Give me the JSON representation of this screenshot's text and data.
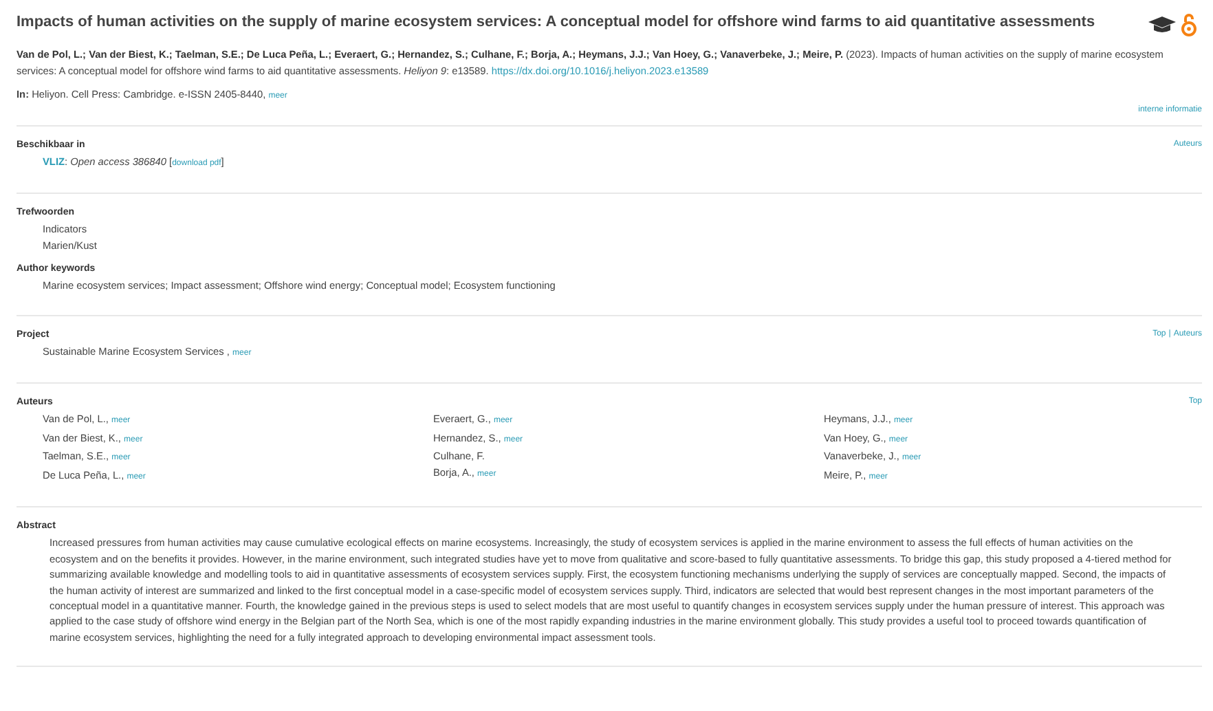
{
  "title": "Impacts of human activities on the supply of marine ecosystem services: A conceptual model for offshore wind farms to aid quantitative assessments",
  "citation": {
    "text": "**Van de Pol, L.; Van der Biest, K.; Taelman, S.E.; De Luca Peña, L.; Everaert, G.; Hernandez, S.; Culhane, F.; Borja, A.; Heymans, J.J.; Van Hoey, G.; Vanaverbeke, J.; Meire, P.** (2023). Impacts of human activities on the supply of marine ecosystem services: A conceptual model for offshore wind farms to aid quantitative assessments. *Heliyon 9*: e13589.",
    "link": "https://dx.doi.org/10.1016/j.heliyon.2023.e13589"
  },
  "source": {
    "label": "In:",
    "text": "Heliyon. Cell Press: Cambridge. e-ISSN 2405-8440,",
    "more": "meer"
  },
  "internal_link": "interne informatie",
  "available": {
    "heading": "Beschikbaar in",
    "nav": [
      "Auteurs"
    ],
    "org": "VLIZ",
    "text": ": *Open access 386840* [",
    "download": "download pdf",
    "close": "]"
  },
  "keywords": {
    "heading": "Trefwoorden",
    "items": [
      "Indicators",
      "Marien/Kust"
    ]
  },
  "author_keywords": {
    "heading": "Author keywords",
    "text": "Marine ecosystem services; Impact assessment; Offshore wind energy; Conceptual model; Ecosystem functioning"
  },
  "project": {
    "heading": "Project",
    "nav": [
      "Top",
      "Auteurs"
    ],
    "nav_separator": "|",
    "items": [
      {
        "name": "Sustainable Marine Ecosystem Services ,",
        "more": "meer"
      }
    ]
  },
  "authors": {
    "heading": "Auteurs",
    "nav": [
      "Top"
    ],
    "columns": [
      [
        {
          "name": "Van de Pol, L.,",
          "more": "meer"
        },
        {
          "name": "Van der Biest, K.,",
          "more": "meer"
        },
        {
          "name": "Taelman, S.E.,",
          "more": "meer"
        },
        {
          "name": "De Luca Peña, L.,",
          "more": "meer"
        }
      ],
      [
        {
          "name": "Everaert, G.,",
          "more": "meer"
        },
        {
          "name": "Hernandez, S.,",
          "more": "meer"
        },
        {
          "name": "Culhane, F."
        },
        {
          "name": "Borja, A.,",
          "more": "meer"
        }
      ],
      [
        {
          "name": "Heymans, J.J.,",
          "more": "meer"
        },
        {
          "name": "Van Hoey, G.,",
          "more": "meer"
        },
        {
          "name": "Vanaverbeke, J.,",
          "more": "meer"
        },
        {
          "name": "Meire, P.,",
          "more": "meer"
        }
      ]
    ]
  },
  "abstract": {
    "heading": "Abstract",
    "text": "Increased pressures from human activities may cause cumulative ecological effects on marine ecosystems. Increasingly, the study of ecosystem services is applied in the marine environment to assess the full effects of human activities on the ecosystem and on the benefits it provides. However, in the marine environment, such integrated studies have yet to move from qualitative and score-based to fully quantitative assessments. To bridge this gap, this study proposed a 4-tiered method for summarizing available knowledge and modelling tools to aid in quantitative assessments of ecosystem services supply. First, the ecosystem functioning mechanisms underlying the supply of services are conceptually mapped. Second, the impacts of the human activity of interest are summarized and linked to the first conceptual model in a case-specific model of ecosystem services supply. Third, indicators are selected that would best represent changes in the most important parameters of the conceptual model in a quantitative manner. Fourth, the knowledge gained in the previous steps is used to select models that are most useful to quantify changes in ecosystem services supply under the human pressure of interest. This approach was applied to the case study of offshore wind energy in the Belgian part of the North Sea, which is one of the most rapidly expanding industries in the marine environment globally. This study provides a useful tool to proceed towards quantification of marine ecosystem services, highlighting the need for a fully integrated approach to developing environmental impact assessment tools."
  }
}
